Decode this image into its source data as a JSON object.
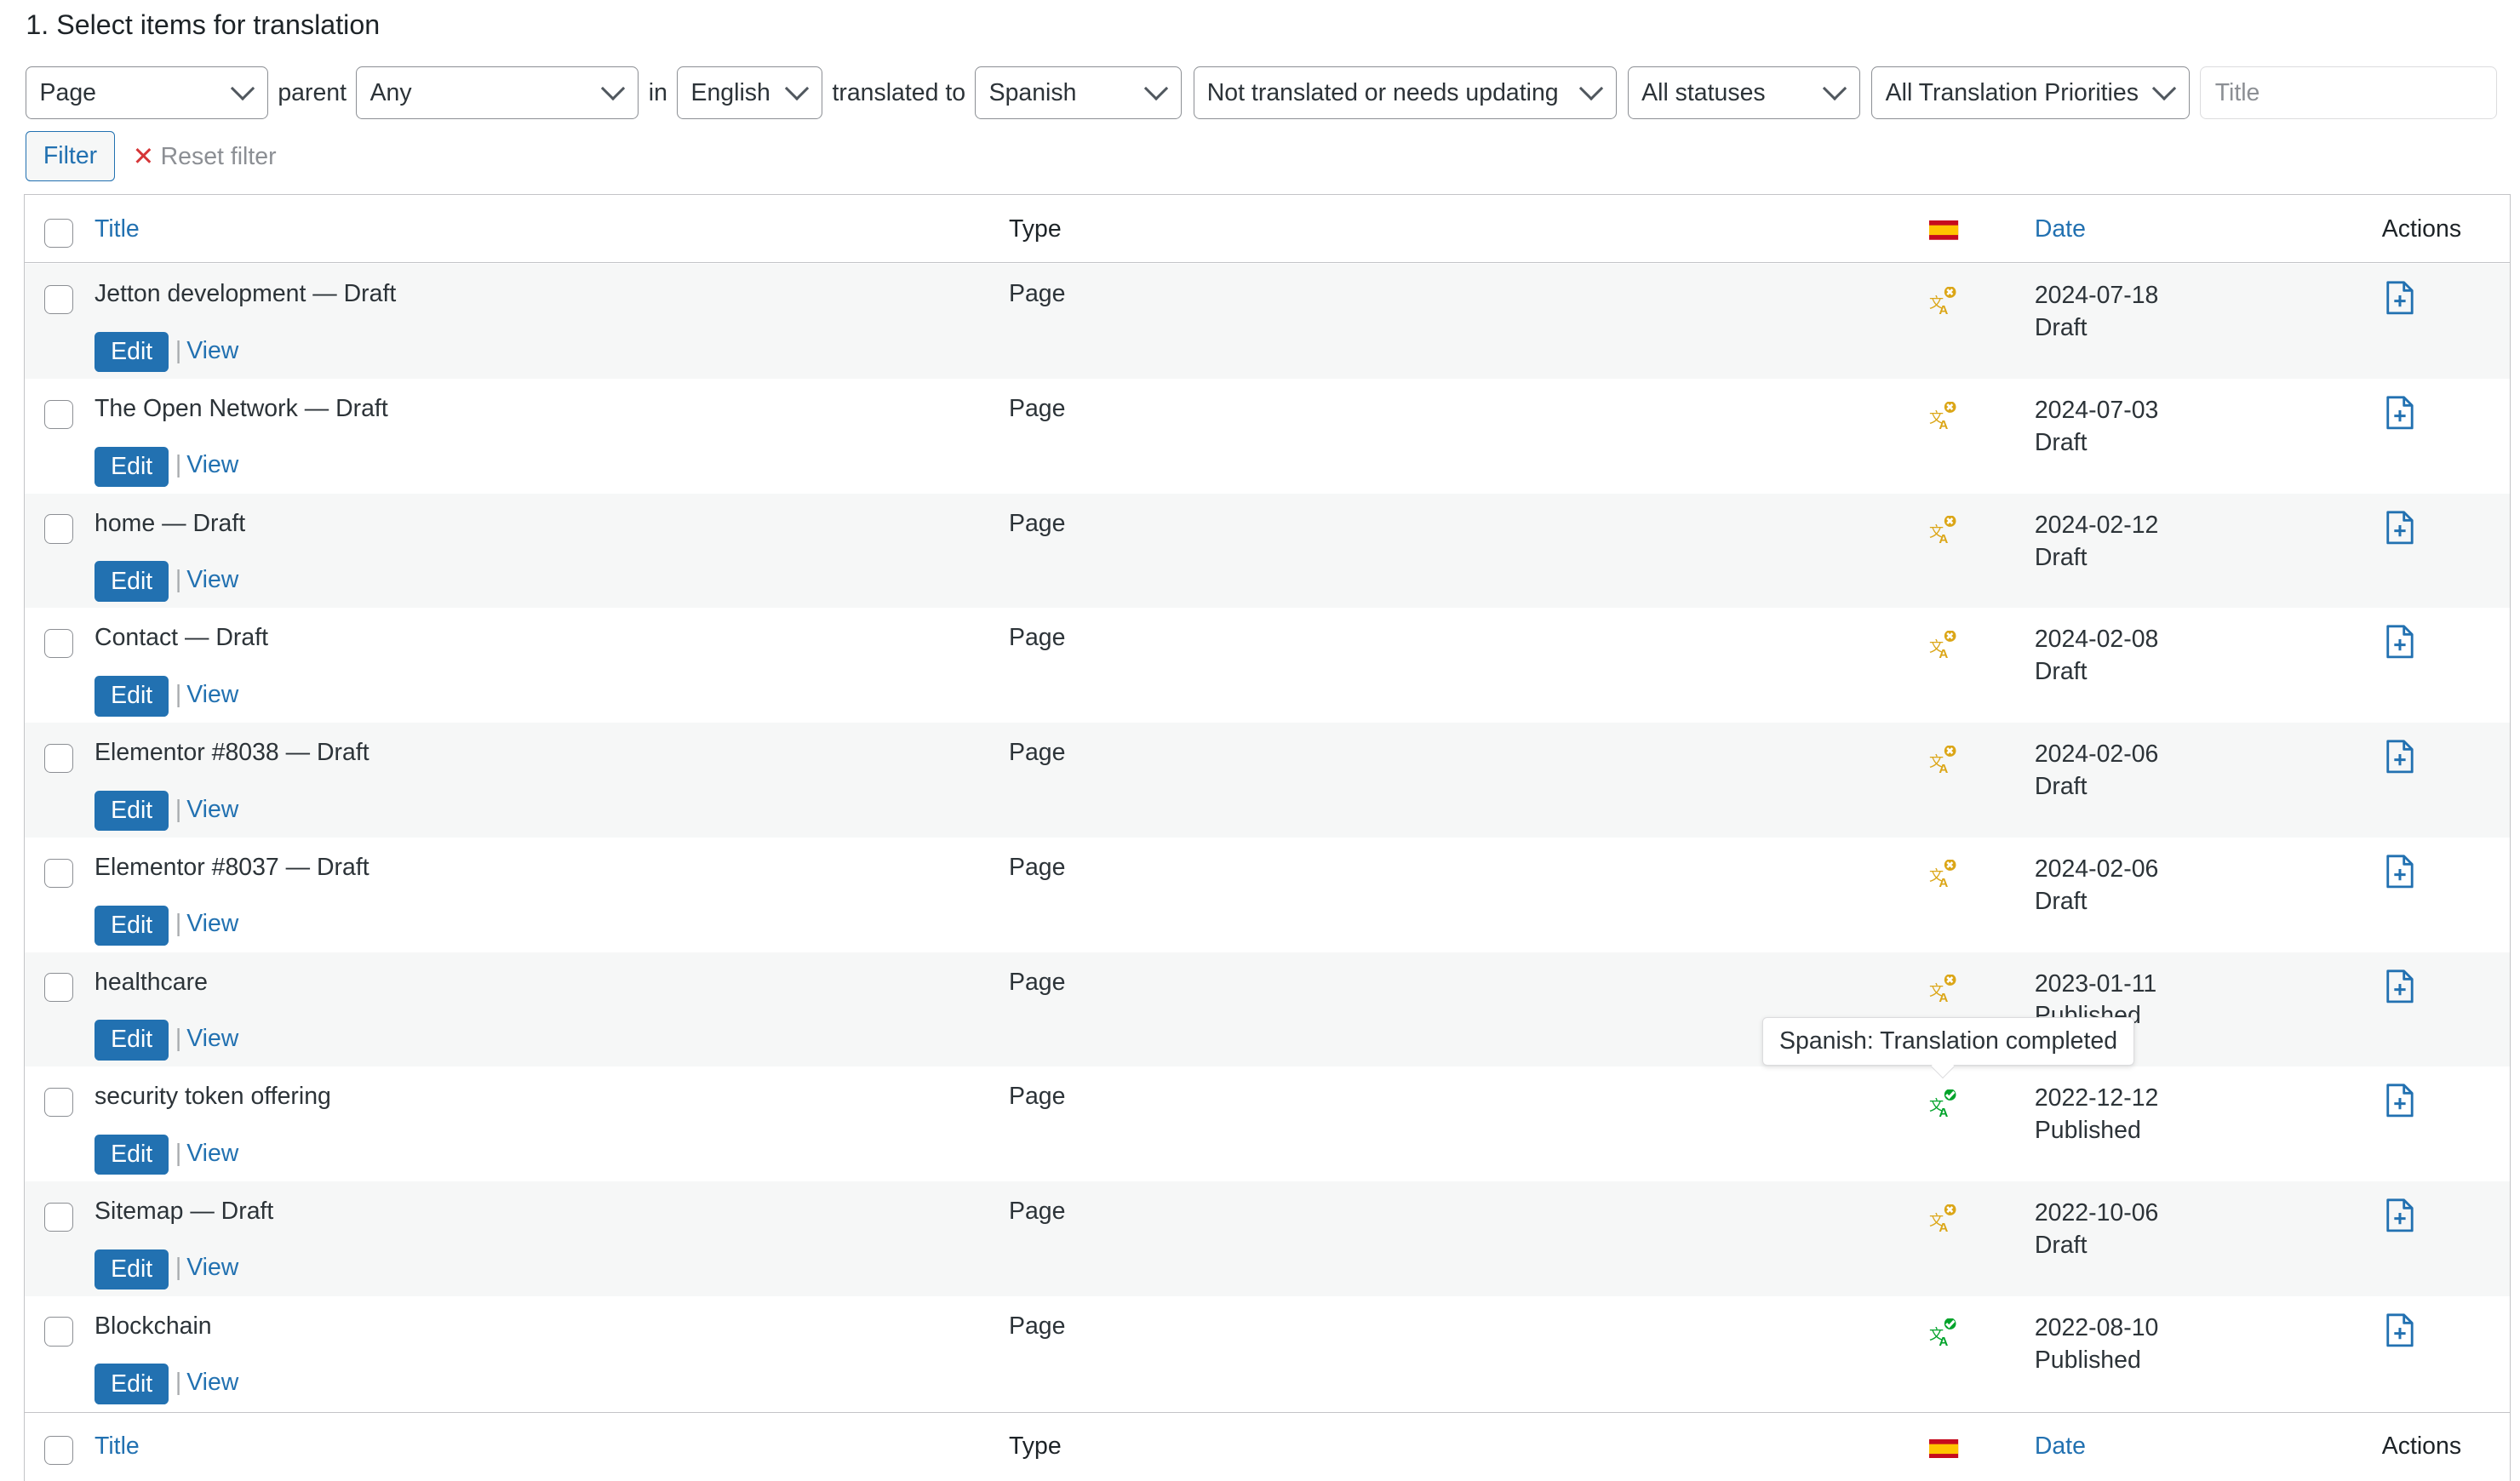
{
  "heading": "1. Select items for translation",
  "filters": {
    "post_type": "Page",
    "parent_label": "parent",
    "parent": "Any",
    "in_label": "in",
    "source_language": "English",
    "translated_to_label": "translated to",
    "target_language": "Spanish",
    "translation_status": "Not translated or needs updating",
    "post_status": "All statuses",
    "priority": "All Translation Priorities",
    "title_placeholder": "Title",
    "filter_button": "Filter",
    "reset_label": "Reset filter"
  },
  "table": {
    "columns": {
      "title": "Title",
      "type": "Type",
      "date": "Date",
      "actions": "Actions"
    },
    "language_flag": "flag-spain-icon",
    "edit_label": "Edit",
    "separator": "|",
    "view_label": "View",
    "rows": [
      {
        "title": "Jetton development — Draft",
        "type": "Page",
        "date": "2024-07-18",
        "status": "Draft",
        "translation": "needs-translation"
      },
      {
        "title": "The Open Network — Draft",
        "type": "Page",
        "date": "2024-07-03",
        "status": "Draft",
        "translation": "needs-translation"
      },
      {
        "title": "home — Draft",
        "type": "Page",
        "date": "2024-02-12",
        "status": "Draft",
        "translation": "needs-translation"
      },
      {
        "title": "Contact — Draft",
        "type": "Page",
        "date": "2024-02-08",
        "status": "Draft",
        "translation": "needs-translation"
      },
      {
        "title": "Elementor #8038 — Draft",
        "type": "Page",
        "date": "2024-02-06",
        "status": "Draft",
        "translation": "needs-translation"
      },
      {
        "title": "Elementor #8037 — Draft",
        "type": "Page",
        "date": "2024-02-06",
        "status": "Draft",
        "translation": "needs-translation"
      },
      {
        "title": "healthcare",
        "type": "Page",
        "date": "2023-01-11",
        "status": "Published",
        "translation": "needs-translation"
      },
      {
        "title": "security token offering",
        "type": "Page",
        "date": "2022-12-12",
        "status": "Published",
        "translation": "completed"
      },
      {
        "title": "Sitemap — Draft",
        "type": "Page",
        "date": "2022-10-06",
        "status": "Draft",
        "translation": "needs-translation"
      },
      {
        "title": "Blockchain",
        "type": "Page",
        "date": "2022-08-10",
        "status": "Published",
        "translation": "completed"
      }
    ]
  },
  "tooltip": "Spanish: Translation completed",
  "colors": {
    "accent": "#2271b1",
    "needs_translation": "#dba617",
    "completed": "#00a32a"
  }
}
